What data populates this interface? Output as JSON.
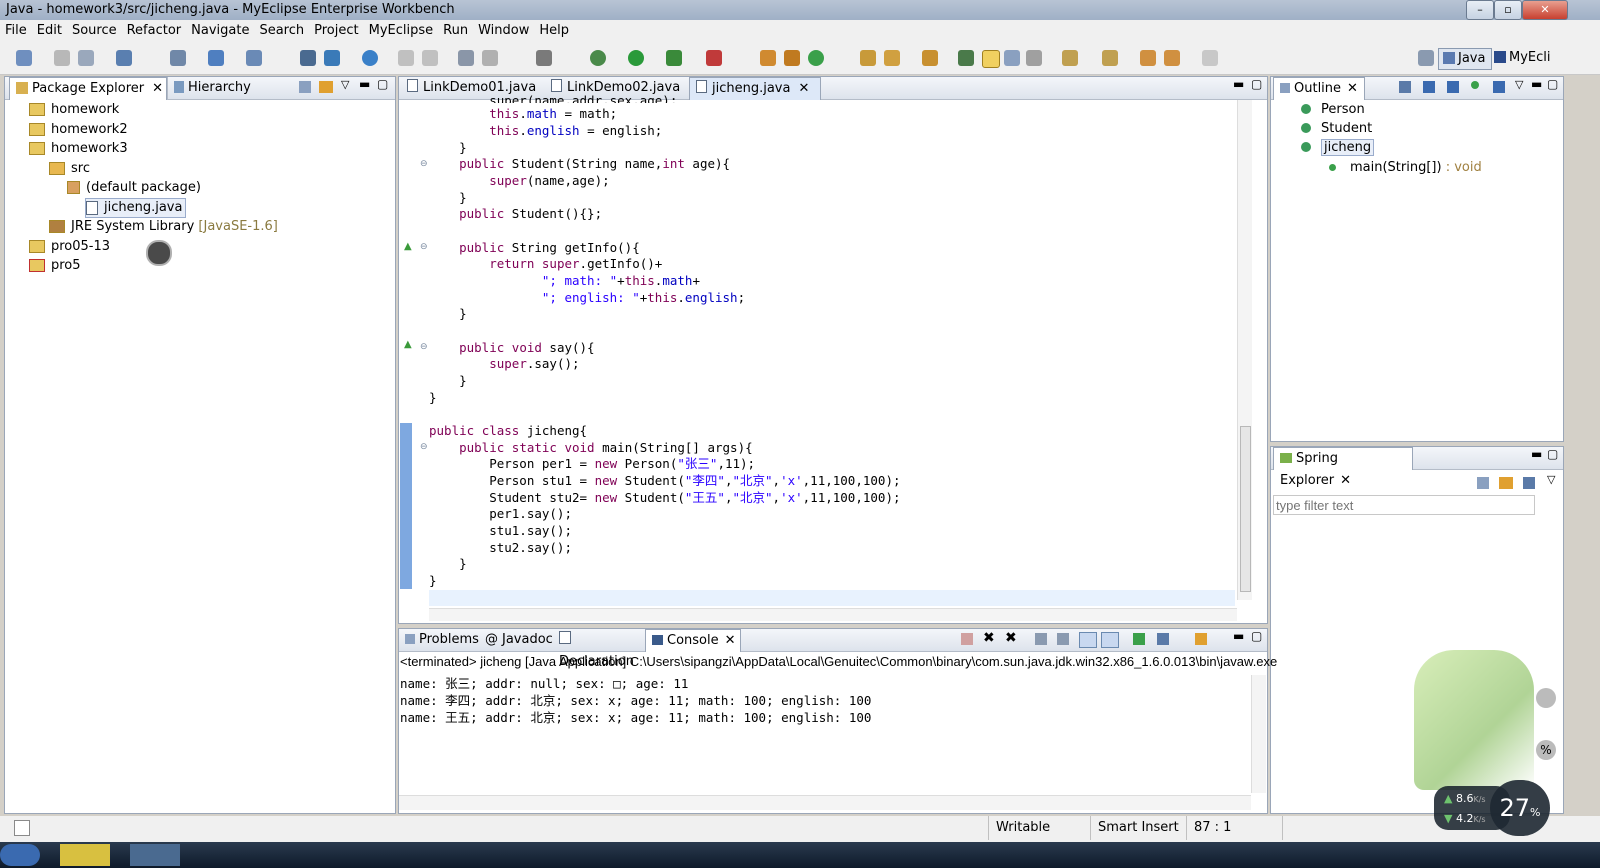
{
  "window": {
    "title": "Java - homework3/src/jicheng.java - MyEclipse Enterprise Workbench",
    "minimize": "–",
    "maximize": "▫",
    "close": "✕"
  },
  "menu": [
    "File",
    "Edit",
    "Source",
    "Refactor",
    "Navigate",
    "Search",
    "Project",
    "MyEclipse",
    "Run",
    "Window",
    "Help"
  ],
  "perspectives": {
    "java": "Java",
    "myeclipse": "MyEcli"
  },
  "package_explorer": {
    "tab": "Package Explorer",
    "hierarchy_tab": "Hierarchy",
    "items": [
      {
        "label": "homework"
      },
      {
        "label": "homework2"
      },
      {
        "label": "homework3"
      },
      {
        "label": "src"
      },
      {
        "label": "(default package)"
      },
      {
        "label": "jicheng.java"
      },
      {
        "label": "JRE System Library",
        "suffix": "[JavaSE-1.6]"
      },
      {
        "label": "pro05-13"
      },
      {
        "label": "pro5"
      }
    ]
  },
  "editor": {
    "tabs": [
      "LinkDemo01.java",
      "LinkDemo02.java",
      "jicheng.java"
    ],
    "lines": [
      "        super(name,addr,sex,age);",
      "        this.math = math;",
      "        this.english = english;",
      "    }",
      "    public Student(String name,int age){",
      "        super(name,age);",
      "    }",
      "    public Student(){};",
      "",
      "    public String getInfo(){",
      "        return super.getInfo()+",
      "               \"; math: \"+this.math+",
      "               \"; english: \"+this.english;",
      "    }",
      "",
      "    public void say(){",
      "        super.say();",
      "    }",
      "}",
      "",
      "public class jicheng{",
      "    public static void main(String[] args){",
      "        Person per1 = new Person(\"张三\",11);",
      "        Person stu1 = new Student(\"李四\",\"北京\",'x',11,100,100);",
      "        Student stu2= new Student(\"王五\",\"北京\",'x',11,100,100);",
      "        per1.say();",
      "        stu1.say();",
      "        stu2.say();",
      "    }",
      "}"
    ]
  },
  "outline": {
    "tab": "Outline",
    "items": [
      {
        "label": "Person"
      },
      {
        "label": "Student"
      },
      {
        "label": "jicheng"
      },
      {
        "label": "main(String[])",
        "suffix": " : void"
      }
    ]
  },
  "spring_explorer": {
    "tab": "Spring Explorer",
    "filter_placeholder": "type filter text"
  },
  "bottom_tabs": [
    "Problems",
    "Javadoc",
    "Declaration",
    "Console"
  ],
  "console": {
    "header": "<terminated> jicheng [Java Application] C:\\Users\\sipangzi\\AppData\\Local\\Genuitec\\Common\\binary\\com.sun.java.jdk.win32.x86_1.6.0.013\\bin\\javaw.exe",
    "lines": [
      "name: 张三; addr: null; sex: □; age: 11",
      "name: 李四; addr: 北京; sex: x; age: 11; math: 100; english: 100",
      "name: 王五; addr: 北京; sex: x; age: 11; math: 100; english: 100"
    ]
  },
  "status": {
    "writable": "Writable",
    "insert_mode": "Smart Insert",
    "position": "87 : 1"
  },
  "widget": {
    "up_speed": "8.6",
    "down_speed": "4.2",
    "speed_unit": "K/s",
    "percent": "27",
    "percent_unit": "%"
  }
}
